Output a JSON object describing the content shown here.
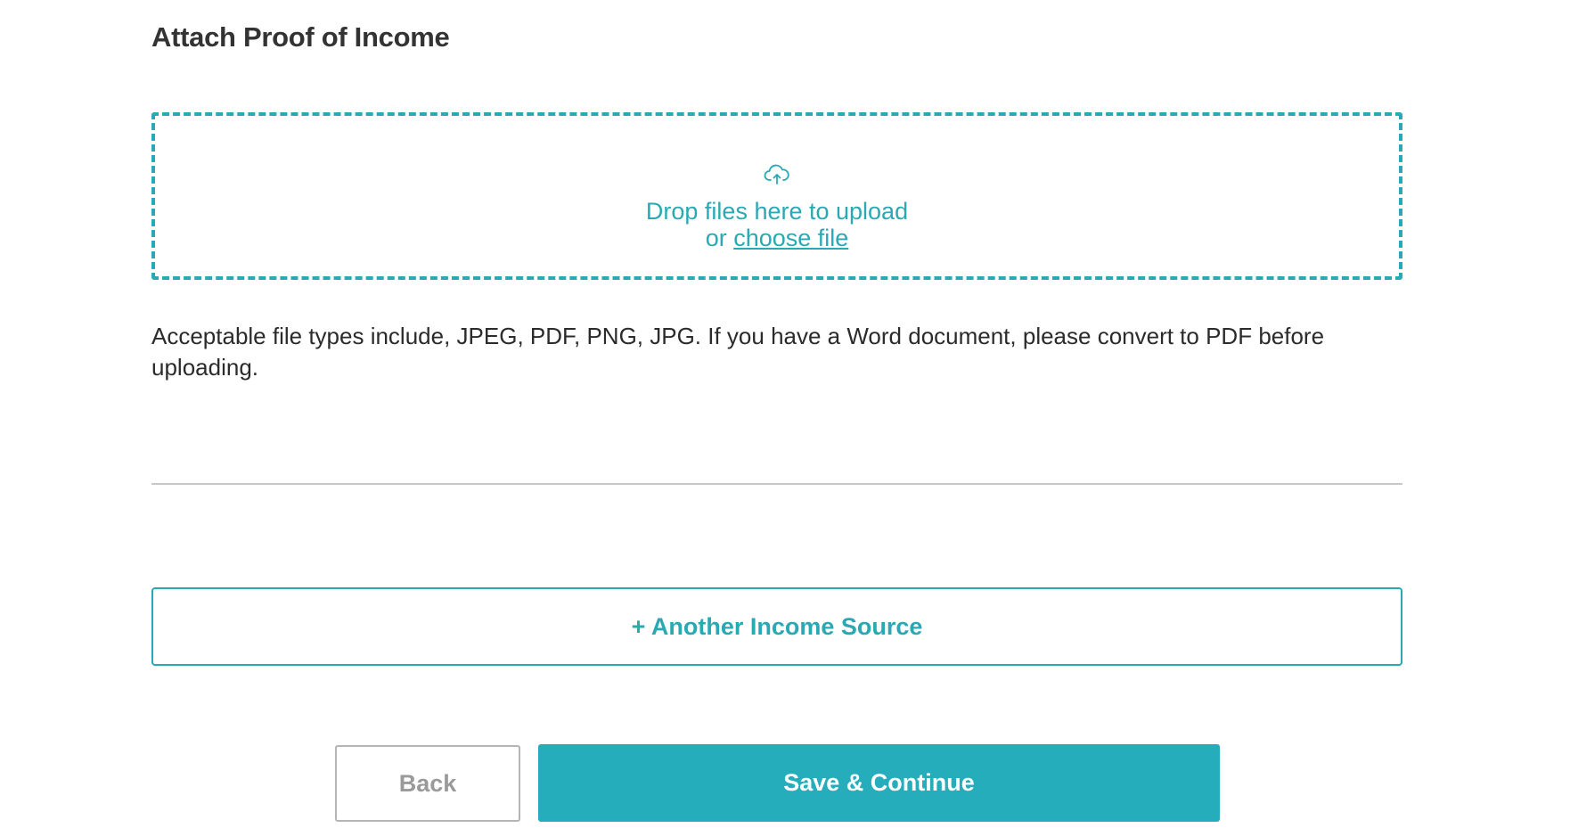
{
  "section": {
    "title": "Attach Proof of Income"
  },
  "upload": {
    "icon": "cloud-upload-icon",
    "drop_text": "Drop files here to upload",
    "or_text": "or ",
    "choose_label": "choose file"
  },
  "note": {
    "text": "Acceptable file types include, JPEG, PDF, PNG, JPG. If you have a Word document, please convert to PDF before uploading."
  },
  "actions": {
    "another_income_label": "+ Another Income Source",
    "back_label": "Back",
    "save_label": "Save & Continue"
  },
  "colors": {
    "accent": "#2aa9b4",
    "primary_button": "#25adbb",
    "text": "#333333",
    "muted": "#9a9a9a"
  }
}
